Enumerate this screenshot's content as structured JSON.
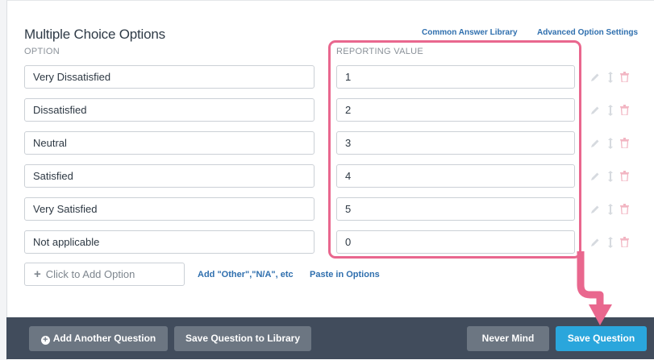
{
  "section": {
    "title": "Multiple Choice Options",
    "common_library_link": "Common Answer Library",
    "advanced_settings_link": "Advanced Option Settings"
  },
  "columns": {
    "option": "OPTION",
    "reporting_value": "REPORTING VALUE"
  },
  "rows": [
    {
      "option": "Very Dissatisfied",
      "value": "1"
    },
    {
      "option": "Dissatisfied",
      "value": "2"
    },
    {
      "option": "Neutral",
      "value": "3"
    },
    {
      "option": "Satisfied",
      "value": "4"
    },
    {
      "option": "Very Satisfied",
      "value": "5"
    },
    {
      "option": "Not applicable",
      "value": "0"
    }
  ],
  "add_option": {
    "placeholder": "Click to Add Option",
    "other_link": "Add \"Other\",\"N/A\", etc",
    "paste_link": "Paste in Options"
  },
  "footer": {
    "add_question": "Add Another Question",
    "save_to_library": "Save Question to Library",
    "never_mind": "Never Mind",
    "save_question": "Save Question"
  },
  "colors": {
    "highlight": "#e9678e",
    "link": "#2f6fae",
    "primary_button": "#2aa6dc",
    "footer": "#414c5c"
  }
}
